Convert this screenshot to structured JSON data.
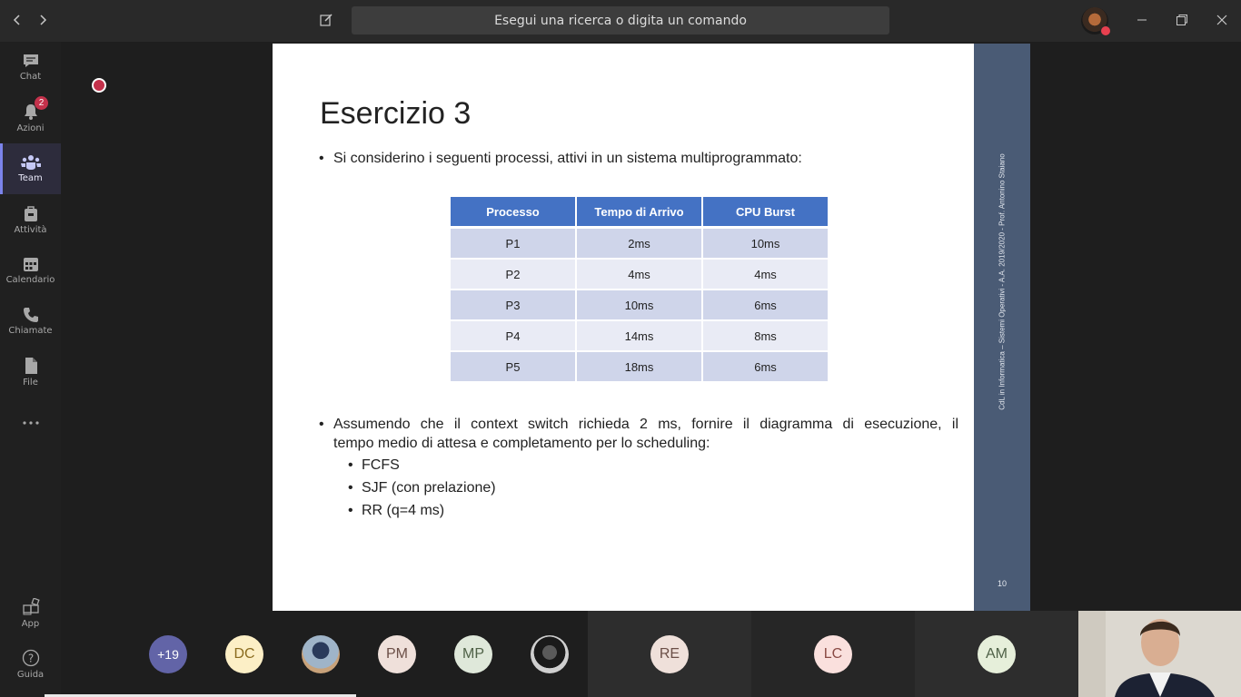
{
  "titlebar": {
    "search_placeholder": "Esegui una ricerca o digita un comando"
  },
  "sidebar": {
    "items": [
      {
        "label": "Chat",
        "icon": "chat-icon"
      },
      {
        "label": "Azioni",
        "icon": "bell-icon",
        "badge": "2"
      },
      {
        "label": "Team",
        "icon": "teams-icon",
        "active": true
      },
      {
        "label": "Attività",
        "icon": "briefcase-icon"
      },
      {
        "label": "Calendario",
        "icon": "calendar-icon"
      },
      {
        "label": "Chiamate",
        "icon": "phone-icon"
      },
      {
        "label": "File",
        "icon": "file-icon"
      },
      {
        "label": "",
        "icon": "more-icon"
      }
    ],
    "bottom": [
      {
        "label": "App",
        "icon": "apps-icon"
      },
      {
        "label": "Guida",
        "icon": "help-icon"
      }
    ]
  },
  "slide": {
    "title": "Esercizio 3",
    "intro": "Si considerino i seguenti processi, attivi in un sistema multiprogrammato:",
    "table": {
      "headers": [
        "Processo",
        "Tempo di Arrivo",
        "CPU Burst"
      ],
      "rows": [
        [
          "P1",
          "2ms",
          "10ms"
        ],
        [
          "P2",
          "4ms",
          "4ms"
        ],
        [
          "P3",
          "10ms",
          "6ms"
        ],
        [
          "P4",
          "14ms",
          "8ms"
        ],
        [
          "P5",
          "18ms",
          "6ms"
        ]
      ]
    },
    "question_line1": "Assumendo che il context switch richieda 2 ms, fornire il diagramma di esecuzione, il",
    "question_line2": "tempo medio di attesa e completamento per lo scheduling:",
    "sub_items": [
      "FCFS",
      "SJF (con prelazione)",
      "RR (q=4 ms)"
    ],
    "side_text": "CdL in Informatica – Sistemi Operativi - A.A. 2019/2020 - Prof. Antonino Staiano",
    "page_number": "10"
  },
  "participants": {
    "overflow_count": "+19",
    "avatars": [
      {
        "initials": "DC",
        "color": "#fcefc6"
      },
      {
        "initials": "",
        "color": "#6a8aa8"
      },
      {
        "initials": "PM",
        "color": "#efe0da"
      },
      {
        "initials": "MP",
        "color": "#dfe8da"
      },
      {
        "initials": "",
        "color": "#2a2a2a"
      },
      {
        "initials": "RE",
        "color": "#efe0da"
      },
      {
        "initials": "LC",
        "color": "#fae0dd"
      },
      {
        "initials": "AM",
        "color": "#e6efda"
      }
    ]
  },
  "colors": {
    "accent": "#7b83eb",
    "table_header": "#4472c4",
    "slide_band": "#4a5b75",
    "overflow_avatar": "#6264a7"
  }
}
